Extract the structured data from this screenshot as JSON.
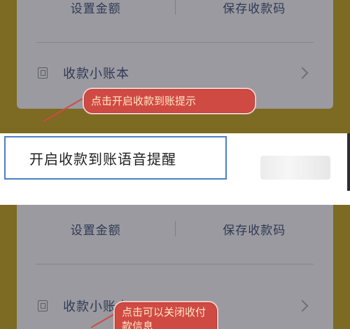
{
  "top_panel": {
    "actions": {
      "set_amount": "设置金额",
      "save_code": "保存收款码"
    },
    "ledger_label": "收款小账本",
    "callout": "点击开启收款到账提示",
    "voice_reminder": "开启收款到账语音提醒"
  },
  "bottom_panel": {
    "actions": {
      "set_amount": "设置金额",
      "save_code": "保存收款码"
    },
    "ledger_label": "收款小账本",
    "callout": "点击可以关闭收付款信息"
  },
  "colors": {
    "callout_fill": "#d04a44",
    "highlight_border": "#4f7ec9",
    "app_yellow": "#7d6a23"
  }
}
